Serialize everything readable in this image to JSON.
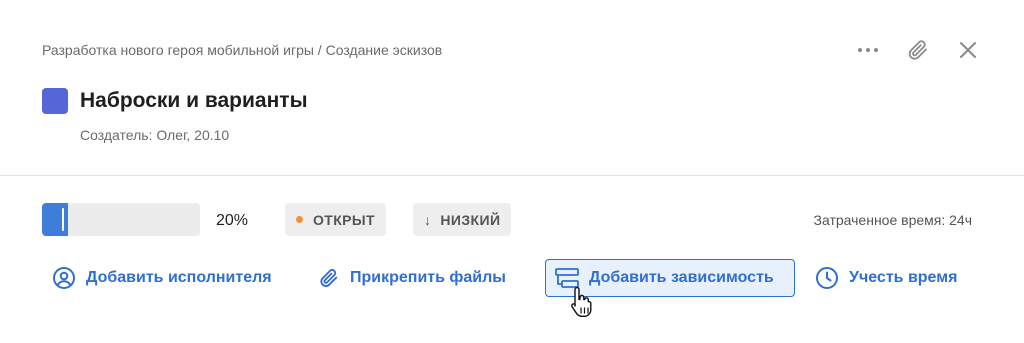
{
  "header": {
    "breadcrumb": "Разработка нового героя мобильной игры / Создание эскизов",
    "actions": [
      {
        "name": "more-icon",
        "icon": "horizontal-dots"
      },
      {
        "name": "attach-icon",
        "icon": "paperclip"
      },
      {
        "name": "close-icon",
        "icon": "x-mark"
      }
    ]
  },
  "task": {
    "title": "Наброски и варианты",
    "color": "#5566d6",
    "creator": "Создатель: Олег, 20.10"
  },
  "details": {
    "progress_fraction": 0.2,
    "progress_label": "20%",
    "status": {
      "label": "ОТКРЫТ",
      "dot_color": "#f0913a"
    },
    "priority": {
      "label": "НИЗКИЙ",
      "icon": "arrow-down"
    },
    "time_spent": "Затраченное время: 24ч"
  },
  "actions": {
    "assign": "Добавить исполнителя",
    "attach": "Прикрепить файлы",
    "dependency": "Добавить зависимость",
    "time": "Учесть время"
  },
  "colors": {
    "accent": "#2f6fcf",
    "progress": "#3f7ed8"
  }
}
